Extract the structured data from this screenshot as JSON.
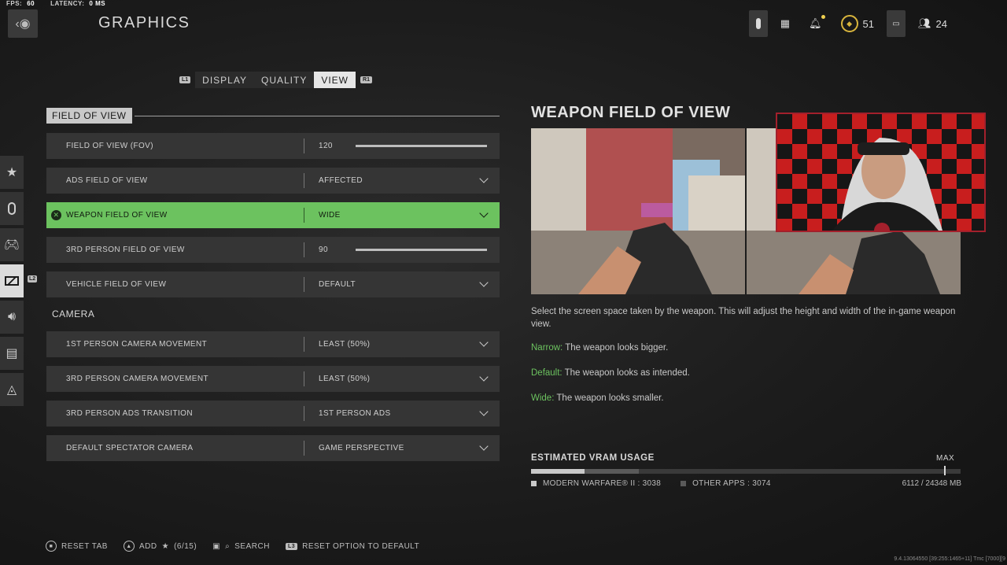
{
  "overlay": {
    "fps_label": "FPS:",
    "fps_value": "60",
    "latency_label": "LATENCY:",
    "latency_value": "0 MS"
  },
  "header": {
    "title": "GRAPHICS",
    "level": "51",
    "party_count": "24"
  },
  "tabs": {
    "left_key": "L1",
    "right_key": "R1",
    "items": [
      {
        "label": "DISPLAY"
      },
      {
        "label": "QUALITY"
      },
      {
        "label": "VIEW"
      }
    ]
  },
  "rail": {
    "active_key": "L2"
  },
  "sections": {
    "fov": "FIELD OF VIEW",
    "camera": "CAMERA"
  },
  "fov_rows": [
    {
      "label": "FIELD OF VIEW (FOV)",
      "value": "120",
      "slider": 1.0
    },
    {
      "label": "ADS FIELD OF VIEW",
      "value": "AFFECTED"
    },
    {
      "label": "WEAPON FIELD OF VIEW",
      "value": "WIDE"
    },
    {
      "label": "3RD PERSON FIELD OF VIEW",
      "value": "90",
      "slider": 1.0
    },
    {
      "label": "VEHICLE FIELD OF VIEW",
      "value": "DEFAULT"
    }
  ],
  "camera_rows": [
    {
      "label": "1ST PERSON CAMERA MOVEMENT",
      "value": "LEAST (50%)"
    },
    {
      "label": "3RD PERSON CAMERA MOVEMENT",
      "value": "LEAST (50%)"
    },
    {
      "label": "3RD PERSON ADS TRANSITION",
      "value": "1ST PERSON ADS"
    },
    {
      "label": "DEFAULT SPECTATOR CAMERA",
      "value": "GAME PERSPECTIVE"
    }
  ],
  "info": {
    "title": "WEAPON FIELD OF VIEW",
    "description": "Select the screen space taken by the weapon. This will adjust the height and width of the in-game weapon view.",
    "options": [
      {
        "key": "Narrow:",
        "text": " The weapon looks bigger."
      },
      {
        "key": "Default:",
        "text": " The weapon looks as intended."
      },
      {
        "key": "Wide:",
        "text": " The weapon looks smaller."
      }
    ]
  },
  "vram": {
    "title": "ESTIMATED VRAM USAGE",
    "max_label": "MAX",
    "mw_label": "MODERN WARFARE® II : 3038",
    "other_label": "OTHER APPS : 3074",
    "total": "6112 / 24348 MB",
    "mw_fraction": 0.125,
    "other_fraction": 0.126,
    "mw_color": "#c9c9c9",
    "other_color": "#5a5a5a"
  },
  "footer": {
    "reset_tab": "RESET TAB",
    "add": "ADD",
    "add_count": "(6/15)",
    "search": "SEARCH",
    "reset_key": "L3",
    "reset_option": "RESET OPTION TO DEFAULT"
  },
  "build": "9.4.13064550 [39:255:1465+11] Tmc [7000][9"
}
